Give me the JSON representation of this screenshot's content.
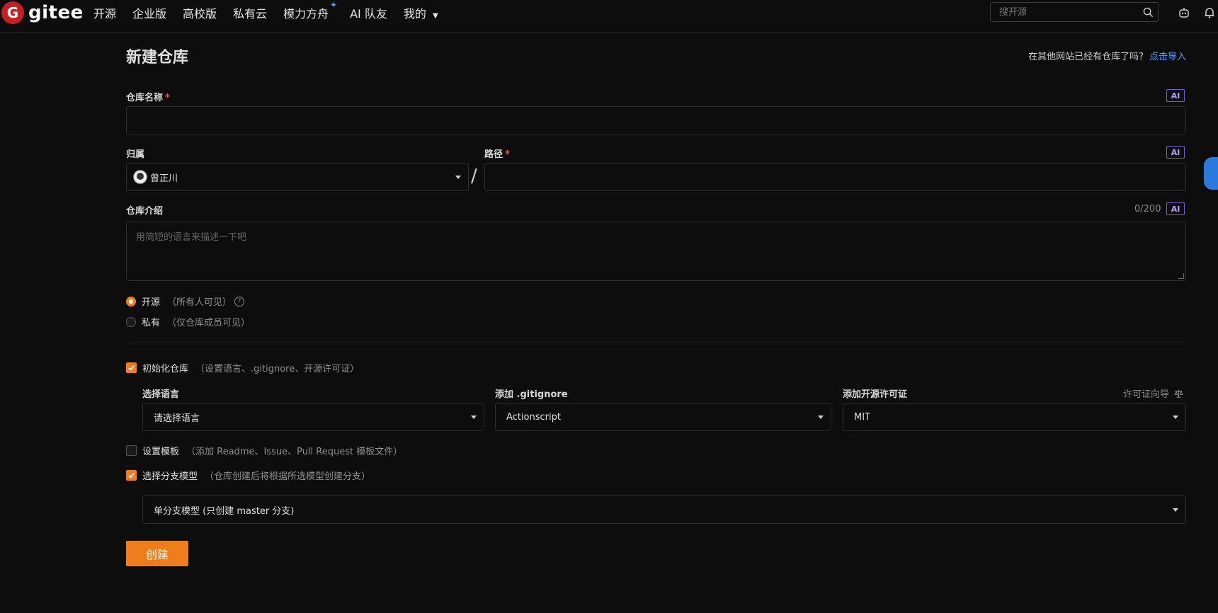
{
  "brand": {
    "logo_letter": "G",
    "name": "gitee"
  },
  "nav": {
    "items": [
      {
        "label": "开源"
      },
      {
        "label": "企业版"
      },
      {
        "label": "高校版"
      },
      {
        "label": "私有云"
      },
      {
        "label": "模力方舟"
      },
      {
        "label": "AI 队友"
      },
      {
        "label": "我的"
      }
    ],
    "search_placeholder": "搜开源"
  },
  "page": {
    "title": "新建仓库",
    "import_prompt": "在其他网站已经有仓库了吗?",
    "import_link": "点击导入"
  },
  "form": {
    "repo_name": {
      "label": "仓库名称",
      "required_mark": "*",
      "ai_badge": "AI",
      "value": ""
    },
    "owner": {
      "label": "归属",
      "value": "曾正川"
    },
    "separator": "/",
    "path": {
      "label": "路径",
      "required_mark": "*",
      "ai_badge": "AI",
      "value": ""
    },
    "description": {
      "label": "仓库介绍",
      "counter": "0/200",
      "ai_badge": "AI",
      "placeholder": "用简短的语言来描述一下吧"
    },
    "visibility": {
      "public": {
        "label": "开源",
        "hint": "（所有人可见）",
        "selected": true
      },
      "private": {
        "label": "私有",
        "hint": "（仅仓库成员可见）",
        "selected": false
      },
      "help_glyph": "?"
    },
    "init_repo": {
      "label": "初始化仓库",
      "hint": "（设置语言、.gitignore、开源许可证）",
      "checked": true
    },
    "language": {
      "label": "选择语言",
      "value": "请选择语言"
    },
    "gitignore": {
      "label": "添加 .gitignore",
      "value": "Actionscript"
    },
    "license": {
      "label": "添加开源许可证",
      "guide": "许可证向导",
      "value": "MIT"
    },
    "template": {
      "label": "设置模板",
      "hint": "（添加 Readme、Issue、Pull Request 模板文件）",
      "checked": false
    },
    "branch_model": {
      "label": "选择分支模型",
      "hint": "（仓库创建后将根据所选模型创建分支）",
      "checked": true,
      "value": "单分支模型 (只创建 master 分支)"
    },
    "submit_label": "创建"
  },
  "colors": {
    "accent": "#f07d1c",
    "link": "#4fa3ff",
    "background": "#0d0d0d",
    "ai_badge_border": "#7c5cd6",
    "brand_red": "#c71d23"
  },
  "icons": [
    "search-icon",
    "robot-icon",
    "bell-icon",
    "help-icon",
    "scale-icon",
    "check-icon",
    "chevron-down-icon"
  ]
}
